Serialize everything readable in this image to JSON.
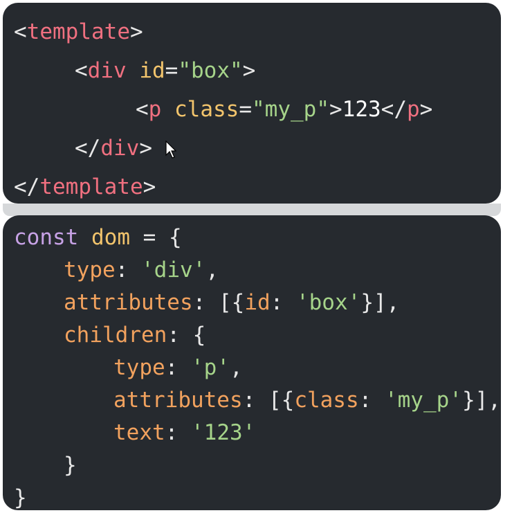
{
  "template_panel": {
    "lines": [
      {
        "open_lt": "<",
        "tag": "template",
        "close_gt": ">"
      },
      {
        "open_lt": "<",
        "tag": "div",
        "attr_name": "id",
        "eq": "=",
        "attr_value": "\"box\"",
        "close_gt": ">"
      },
      {
        "open_lt": "<",
        "tag": "p",
        "attr_name": "class",
        "eq": "=",
        "attr_value": "\"my_p\"",
        "close_gt": ">",
        "content": "123",
        "end_open": "</",
        "end_tag": "p",
        "end_gt": ">"
      },
      {
        "open_lt": "</",
        "tag": "div",
        "close_gt": ">"
      },
      {
        "open_lt": "</",
        "tag": "template",
        "close_gt": ">"
      }
    ]
  },
  "dom_panel": {
    "line1": {
      "keyword": "const",
      "name": "dom",
      "op": "=",
      "brace": "{"
    },
    "line2": {
      "key": "type",
      "colon": ":",
      "value": "'div'",
      "comma": ","
    },
    "line3": {
      "key": "attributes",
      "colon": ":",
      "open": "[{",
      "inner_key": "id",
      "inner_colon": ":",
      "value": "'box'",
      "close": "}],"
    },
    "line4": {
      "key": "children",
      "colon": ":",
      "brace": "{"
    },
    "line5": {
      "key": "type",
      "colon": ":",
      "value": "'p'",
      "comma": ","
    },
    "line6": {
      "key": "attributes",
      "colon": ":",
      "open": "[{",
      "inner_key": "class",
      "inner_colon": ":",
      "value": "'my_p'",
      "close": "}],"
    },
    "line7": {
      "key": "text",
      "colon": ":",
      "value": "'123'"
    },
    "line8": {
      "brace": "}"
    },
    "line9": {
      "brace": "}"
    }
  },
  "icons": {
    "cursor": "mouse-pointer-icon"
  }
}
